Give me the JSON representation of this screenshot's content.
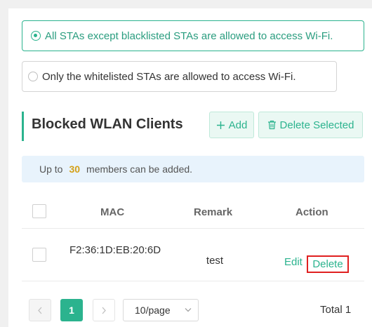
{
  "access_mode": {
    "options": [
      {
        "label": "All STAs except blacklisted STAs are allowed to access Wi-Fi.",
        "selected": true
      },
      {
        "label": "Only the whitelisted STAs are allowed to access Wi-Fi.",
        "selected": false
      }
    ]
  },
  "section": {
    "title": "Blocked WLAN Clients",
    "add_label": "Add",
    "delete_selected_label": "Delete Selected"
  },
  "notice": {
    "prefix": "Up to",
    "max_members": "30",
    "suffix": "members can be added."
  },
  "table": {
    "columns": [
      "MAC",
      "Remark",
      "Action"
    ],
    "rows": [
      {
        "mac": "F2:36:1D:EB:20:6D",
        "remark": "test",
        "edit_label": "Edit",
        "delete_label": "Delete"
      }
    ]
  },
  "pagination": {
    "current_page": "1",
    "page_size": "10/page",
    "total": "Total 1"
  },
  "colors": {
    "accent": "#2bb38e",
    "highlight_border": "#e02020",
    "notice_bg": "#e8f3fc",
    "count_color": "#d4a017"
  },
  "icons": {
    "add": "plus-icon",
    "delete_selected": "trash-icon",
    "prev": "chevron-left-icon",
    "next": "chevron-right-icon",
    "page_size": "chevron-down-icon"
  }
}
